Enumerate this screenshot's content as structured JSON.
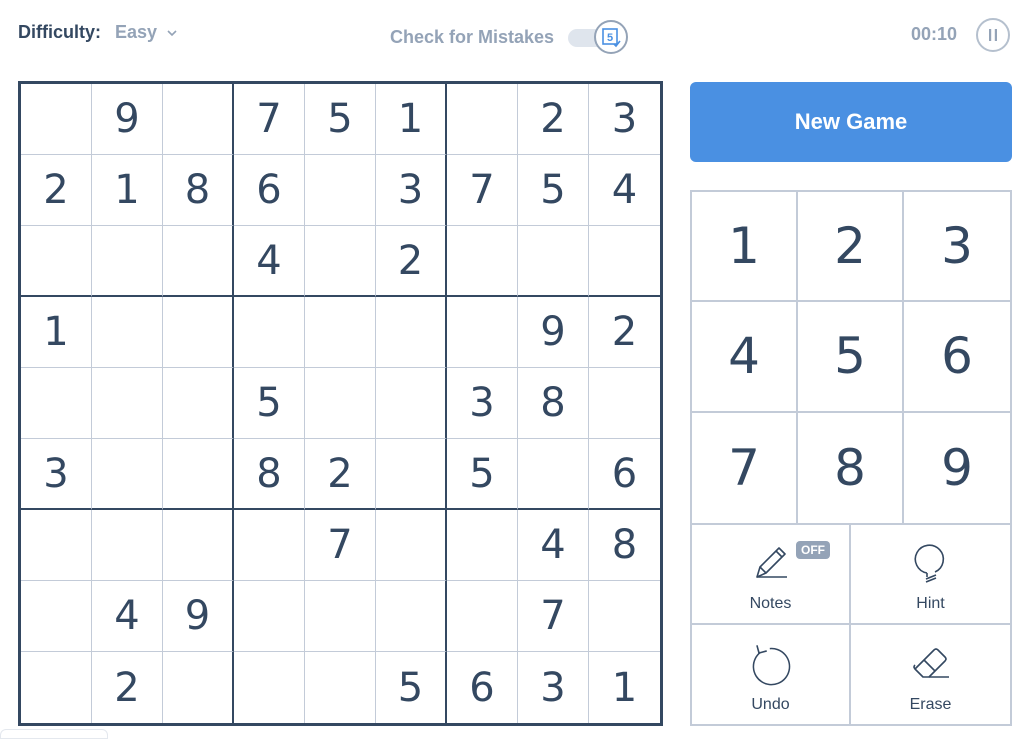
{
  "header": {
    "difficulty_label": "Difficulty:",
    "difficulty_value": "Easy",
    "check_mistakes_label": "Check for Mistakes",
    "check_mistakes_enabled": false,
    "mistakes_badge": "5",
    "timer": "00:10"
  },
  "board": {
    "rows": [
      [
        "",
        "9",
        "",
        "7",
        "5",
        "1",
        "",
        "2",
        "3"
      ],
      [
        "2",
        "1",
        "8",
        "6",
        "",
        "3",
        "7",
        "5",
        "4"
      ],
      [
        "",
        "",
        "",
        "4",
        "",
        "2",
        "",
        "",
        ""
      ],
      [
        "1",
        "",
        "",
        "",
        "",
        "",
        "",
        "9",
        "2"
      ],
      [
        "",
        "",
        "",
        "5",
        "",
        "",
        "3",
        "8",
        ""
      ],
      [
        "3",
        "",
        "",
        "8",
        "2",
        "",
        "5",
        "",
        "6"
      ],
      [
        "",
        "",
        "",
        "",
        "7",
        "",
        "",
        "4",
        "8"
      ],
      [
        "",
        "4",
        "9",
        "",
        "",
        "",
        "",
        "7",
        ""
      ],
      [
        "",
        "2",
        "",
        "",
        "",
        "5",
        "6",
        "3",
        "1"
      ]
    ]
  },
  "sidebar": {
    "new_game_label": "New Game",
    "numpad": [
      "1",
      "2",
      "3",
      "4",
      "5",
      "6",
      "7",
      "8",
      "9"
    ],
    "actions": [
      {
        "label": "Notes",
        "icon": "pencil-icon",
        "badge": "OFF"
      },
      {
        "label": "Hint",
        "icon": "lightbulb-icon"
      },
      {
        "label": "Undo",
        "icon": "undo-icon"
      },
      {
        "label": "Erase",
        "icon": "eraser-icon"
      }
    ]
  },
  "colors": {
    "accent": "#4a90e2",
    "text": "#344861",
    "muted": "#94a3b7",
    "grid_thin": "#c3cbd8"
  }
}
